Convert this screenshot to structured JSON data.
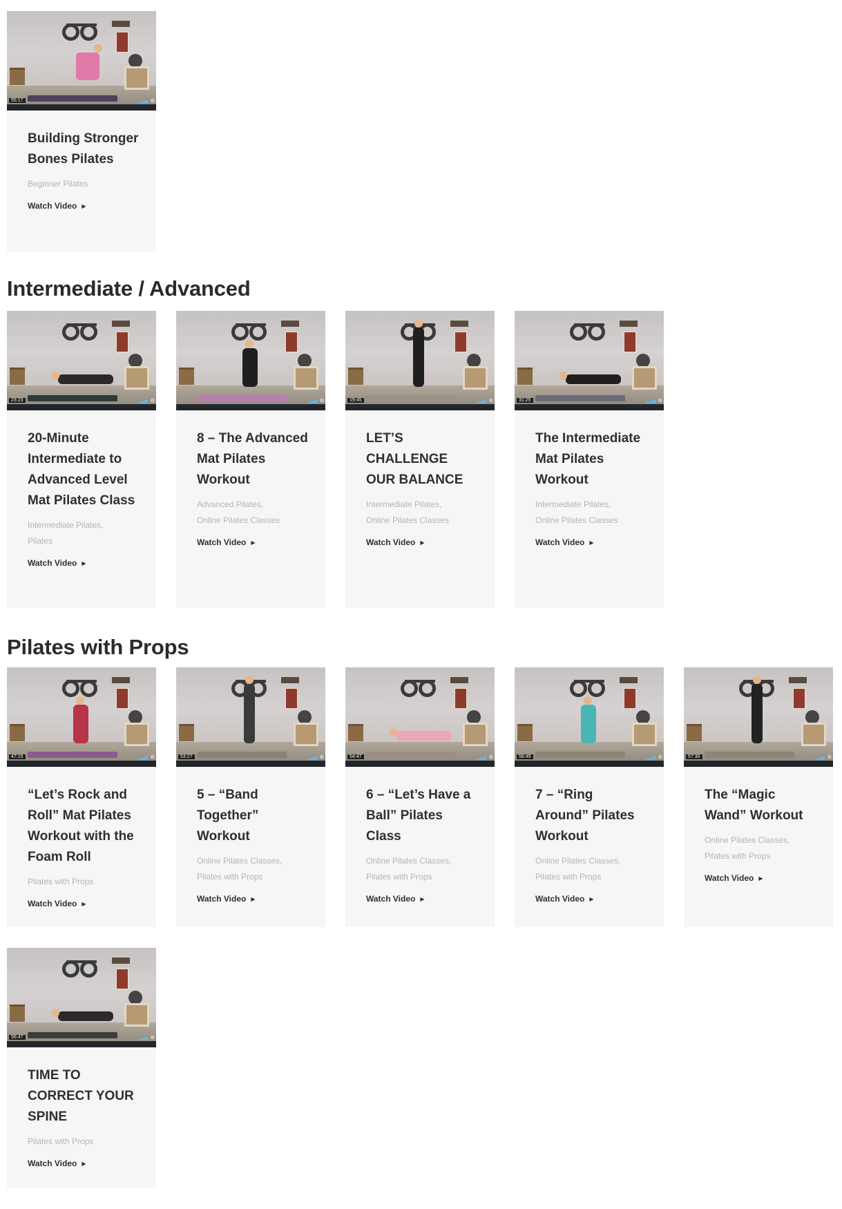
{
  "sections": [
    {
      "title": "",
      "cards": [
        {
          "title": "Building Stronger Bones Pilates",
          "categories": [
            "Beginner Pilates"
          ],
          "watch_label": "Watch Video",
          "duration": "55:17"
        }
      ]
    },
    {
      "title": "Intermediate / Advanced",
      "cards": [
        {
          "title": "20-Minute Intermediate to Advanced Level Mat Pilates Class",
          "categories": [
            "Intermediate Pilates,",
            "Pilates"
          ],
          "watch_label": "Watch Video",
          "duration": "23:23"
        },
        {
          "title": "8 – The Advanced Mat Pilates Workout",
          "categories": [
            "Advanced Pilates,",
            "Online Pilates Classes"
          ],
          "watch_label": "Watch Video",
          "duration": ""
        },
        {
          "title": "LET’S CHALLENGE OUR BALANCE",
          "categories": [
            "Intermediate Pilates,",
            "Online Pilates Classes"
          ],
          "watch_label": "Watch Video",
          "duration": "19:45"
        },
        {
          "title": "The Intermediate Mat Pilates Workout",
          "categories": [
            "Intermediate Pilates,",
            "Online Pilates Classes"
          ],
          "watch_label": "Watch Video",
          "duration": "31:25"
        }
      ]
    },
    {
      "title": "Pilates with Props",
      "cards": [
        {
          "title": "“Let’s Rock and Roll” Mat Pilates Workout with the Foam Roll",
          "categories": [
            "Pilates with Props"
          ],
          "watch_label": "Watch Video",
          "duration": "47:15"
        },
        {
          "title": "5 – “Band Together” Workout",
          "categories": [
            "Online Pilates Classes,",
            "Pilates with Props"
          ],
          "watch_label": "Watch Video",
          "duration": "53:27"
        },
        {
          "title": "6 – “Let’s Have a Ball” Pilates Class",
          "categories": [
            "Online Pilates Classes,",
            "Pilates with Props"
          ],
          "watch_label": "Watch Video",
          "duration": "54:47"
        },
        {
          "title": "7 – “Ring Around” Pilates Workout",
          "categories": [
            "Online Pilates Classes,",
            "Pilates with Props"
          ],
          "watch_label": "Watch Video",
          "duration": "56:49"
        },
        {
          "title": "The “Magic Wand” Workout",
          "categories": [
            "Online Pilates Classes,",
            "Pilates with Props"
          ],
          "watch_label": "Watch Video",
          "duration": "57:30"
        },
        {
          "title": "TIME TO CORRECT YOUR SPINE",
          "categories": [
            "Pilates with Props"
          ],
          "watch_label": "Watch Video",
          "duration": "56:47"
        }
      ]
    }
  ],
  "icons": {
    "caret": "caret-right-icon",
    "settings": "gear-icon"
  },
  "colors": {
    "card_bg": "#f6f6f6",
    "title": "#2f2f2f",
    "category": "#b4b4b4"
  }
}
